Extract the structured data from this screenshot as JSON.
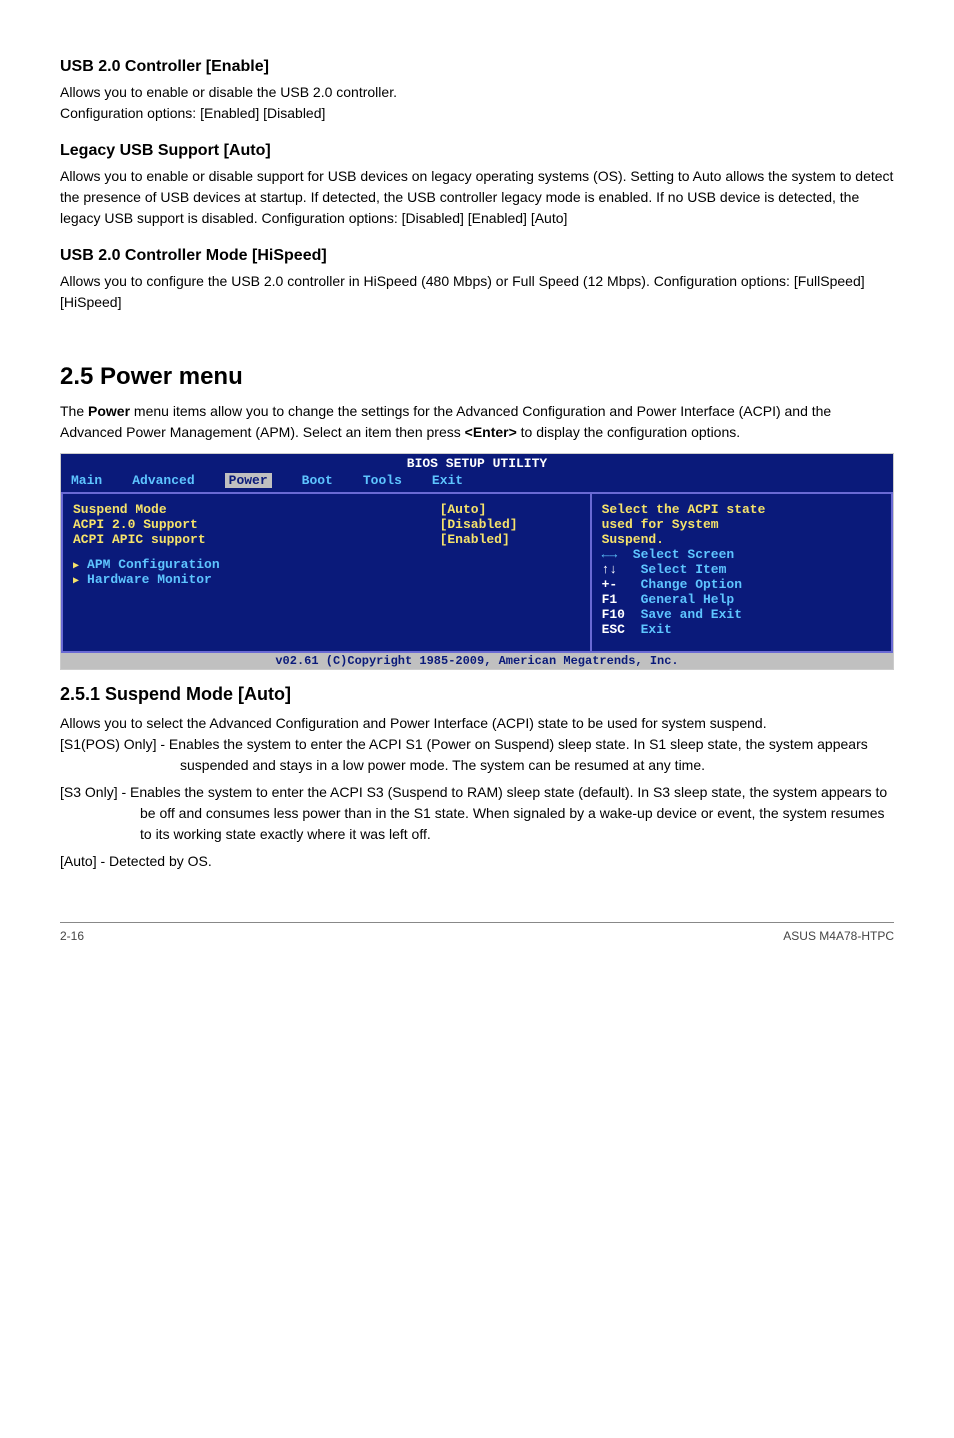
{
  "sec1": {
    "h1": "USB 2.0 Controller [Enable]",
    "p1": "Allows you to enable or disable the USB 2.0 controller.",
    "p2": "Configuration options: [Enabled] [Disabled]",
    "h2": "Legacy USB Support [Auto]",
    "p3": "Allows you to enable or disable support for USB devices on legacy operating systems (OS). Setting to Auto allows the system to detect the presence of USB devices at startup. If detected, the USB controller legacy mode is enabled. If no USB device is detected, the legacy USB support is disabled. Configuration options: [Disabled] [Enabled] [Auto]",
    "h3": "USB 2.0 Controller Mode [HiSpeed]",
    "p4": "Allows you to configure the USB 2.0 controller in HiSpeed (480 Mbps) or Full Speed (12 Mbps). Configuration options: [FullSpeed] [HiSpeed]"
  },
  "power": {
    "heading": "2.5        Power menu",
    "intro1": "The ",
    "intro_bold": "Power",
    "intro2": " menu items allow you to change the settings for the Advanced Configuration and Power Interface (ACPI) and the Advanced Power Management (APM). Select an item then press ",
    "intro_bold2": "<Enter>",
    "intro3": " to display the configuration options."
  },
  "bios": {
    "title": "BIOS SETUP UTILITY",
    "menu": [
      "Main",
      "Advanced",
      "Power",
      "Boot",
      "Tools",
      "Exit"
    ],
    "active": "Power",
    "rows": [
      {
        "label": "Suspend Mode",
        "val": "[Auto]"
      },
      {
        "label": "ACPI 2.0 Support",
        "val": "[Disabled]"
      },
      {
        "label": "ACPI APIC support",
        "val": "[Enabled]"
      }
    ],
    "links": [
      "APM Configuration",
      "Hardware Monitor"
    ],
    "help1": "Select the ACPI state",
    "help2": "used for System",
    "help3": "Suspend.",
    "legend": [
      {
        "k": "←→  ",
        "d": "Select Screen"
      },
      {
        "k": "↑↓   ",
        "d": "Select Item"
      },
      {
        "k": "+-   ",
        "d": "Change Option"
      },
      {
        "k": "F1   ",
        "d": "General Help"
      },
      {
        "k": "F10  ",
        "d": "Save and Exit"
      },
      {
        "k": "ESC  ",
        "d": "Exit"
      }
    ],
    "footer": "v02.61 (C)Copyright 1985-2009, American Megatrends, Inc."
  },
  "suspend": {
    "heading": "2.5.1      Suspend Mode [Auto]",
    "p1": "Allows you to select the Advanced Configuration and Power Interface (ACPI) state to be used for system suspend.",
    "s1": "[S1(POS) Only] - Enables the system to enter the ACPI S1 (Power on Suspend) sleep state. In S1 sleep state, the system appears suspended and stays in a low power mode. The system can be resumed at any time.",
    "s3": "[S3 Only] - Enables the system to enter the ACPI S3 (Suspend to RAM) sleep state (default). In S3 sleep state, the system appears to be off and consumes less power than in the S1 state. When signaled by a wake-up device or event, the system resumes to its working state exactly where it was left off.",
    "auto": "[Auto] - Detected by OS."
  },
  "footer": {
    "left": "2-16",
    "right": "ASUS M4A78-HTPC"
  }
}
